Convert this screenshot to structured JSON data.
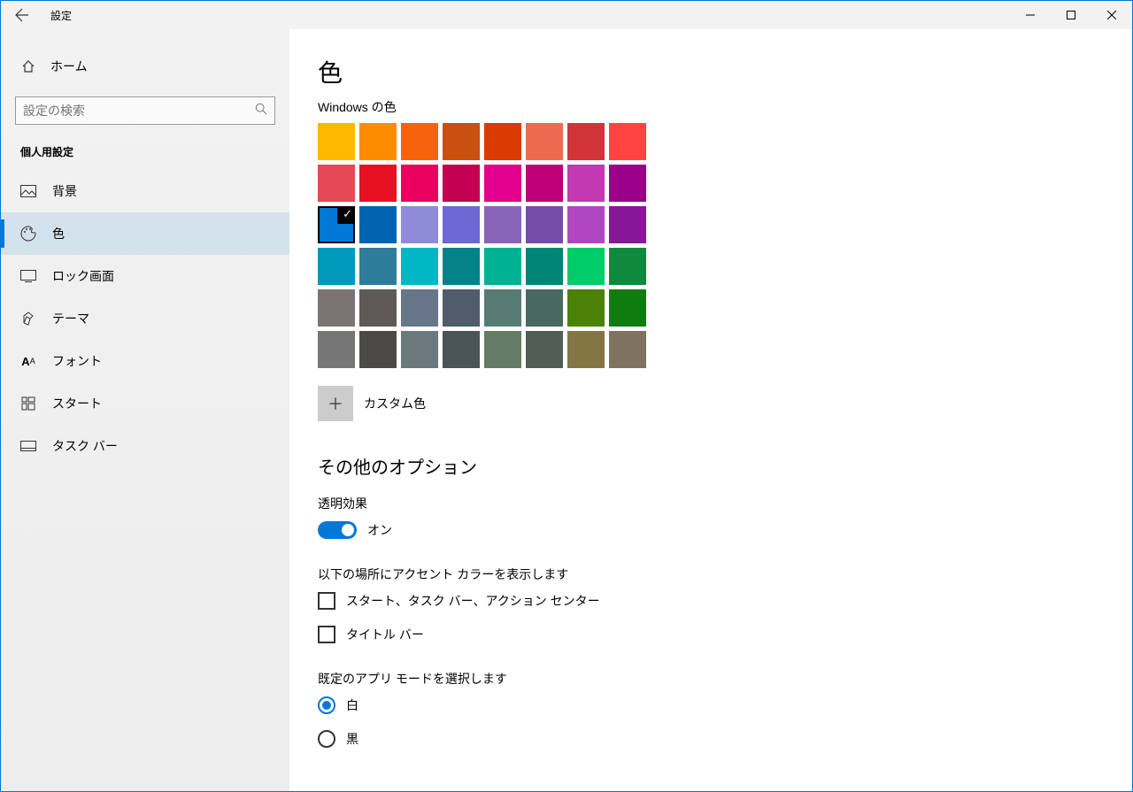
{
  "titlebar": {
    "title": "設定"
  },
  "sidebar": {
    "home": "ホーム",
    "search_placeholder": "設定の検索",
    "section": "個人用設定",
    "items": [
      {
        "label": "背景"
      },
      {
        "label": "色"
      },
      {
        "label": "ロック画面"
      },
      {
        "label": "テーマ"
      },
      {
        "label": "フォント"
      },
      {
        "label": "スタート"
      },
      {
        "label": "タスク バー"
      }
    ]
  },
  "content": {
    "title": "色",
    "windows_colors": "Windows の色",
    "colors": [
      "#ffb900",
      "#ff8c00",
      "#f7630c",
      "#ca5010",
      "#da3b01",
      "#ef6950",
      "#d13438",
      "#ff4343",
      "#e74856",
      "#e81123",
      "#ea005e",
      "#c30052",
      "#e3008c",
      "#bf0077",
      "#c239b3",
      "#9a0089",
      "#0078d7",
      "#0063b1",
      "#8e8cd8",
      "#6b69d6",
      "#8764b8",
      "#744da9",
      "#b146c2",
      "#881798",
      "#0099bc",
      "#2d7d9a",
      "#00b7c3",
      "#038387",
      "#00b294",
      "#018574",
      "#00cc6a",
      "#10893e",
      "#7a7574",
      "#5d5a58",
      "#68768a",
      "#515c6b",
      "#567c73",
      "#486860",
      "#498205",
      "#107c10",
      "#767676",
      "#4c4a48",
      "#69797e",
      "#4a5459",
      "#647c64",
      "#525e54",
      "#847545",
      "#7e735f"
    ],
    "selected_index": 16,
    "custom_label": "カスタム色",
    "other_options": "その他のオプション",
    "transparency": "透明効果",
    "toggle_on": "オン",
    "accent_surfaces": "以下の場所にアクセント カラーを表示します",
    "cb1": "スタート、タスク バー、アクション センター",
    "cb2": "タイトル バー",
    "app_mode": "既定のアプリ モードを選択します",
    "radio_light": "白",
    "radio_dark": "黒"
  }
}
